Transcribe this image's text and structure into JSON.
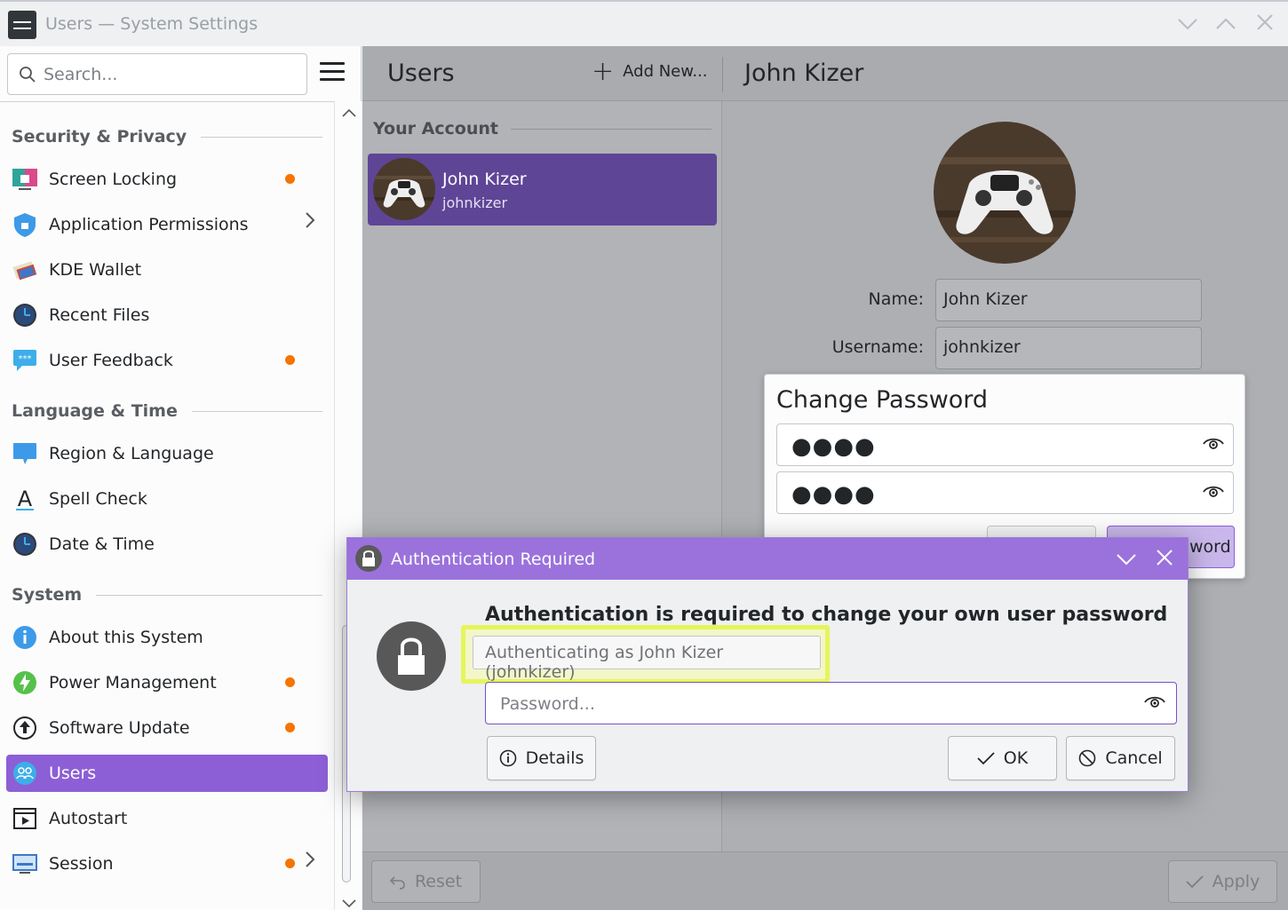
{
  "window": {
    "title": "Users — System Settings"
  },
  "sidebar": {
    "search_placeholder": "Search...",
    "sections": {
      "security": "Security & Privacy",
      "language": "Language & Time",
      "system": "System"
    },
    "items": {
      "screen_locking": "Screen Locking",
      "app_permissions": "Application Permissions",
      "kde_wallet": "KDE Wallet",
      "recent_files": "Recent Files",
      "user_feedback": "User Feedback",
      "region_language": "Region & Language",
      "spell_check": "Spell Check",
      "date_time": "Date & Time",
      "about_system": "About this System",
      "power_management": "Power Management",
      "software_update": "Software Update",
      "users": "Users",
      "autostart": "Autostart",
      "session": "Session"
    },
    "colors": {
      "accent": "#8c5fd6",
      "badge": "#f67400"
    }
  },
  "header": {
    "users_title": "Users",
    "add_new": "Add New...",
    "user_title": "John Kizer"
  },
  "users_list": {
    "section": "Your Account",
    "card_name": "John Kizer",
    "card_login": "johnkizer"
  },
  "details": {
    "name_label": "Name:",
    "name_value": "John Kizer",
    "username_label": "Username:",
    "username_value": "johnkizer"
  },
  "change_password": {
    "title": "Change Password",
    "field1_mask": "●●●●",
    "field2_mask": "●●●●",
    "primary_button": "Set Password",
    "primary_visible": "word"
  },
  "auth_dialog": {
    "title": "Authentication Required",
    "heading": "Authentication is required to change your own user password",
    "subtitle": "Authenticating as John Kizer (johnkizer)",
    "password_placeholder": "Password...",
    "details_button": "Details",
    "ok_button": "OK",
    "cancel_button": "Cancel"
  },
  "footer": {
    "reset": "Reset",
    "apply": "Apply"
  }
}
